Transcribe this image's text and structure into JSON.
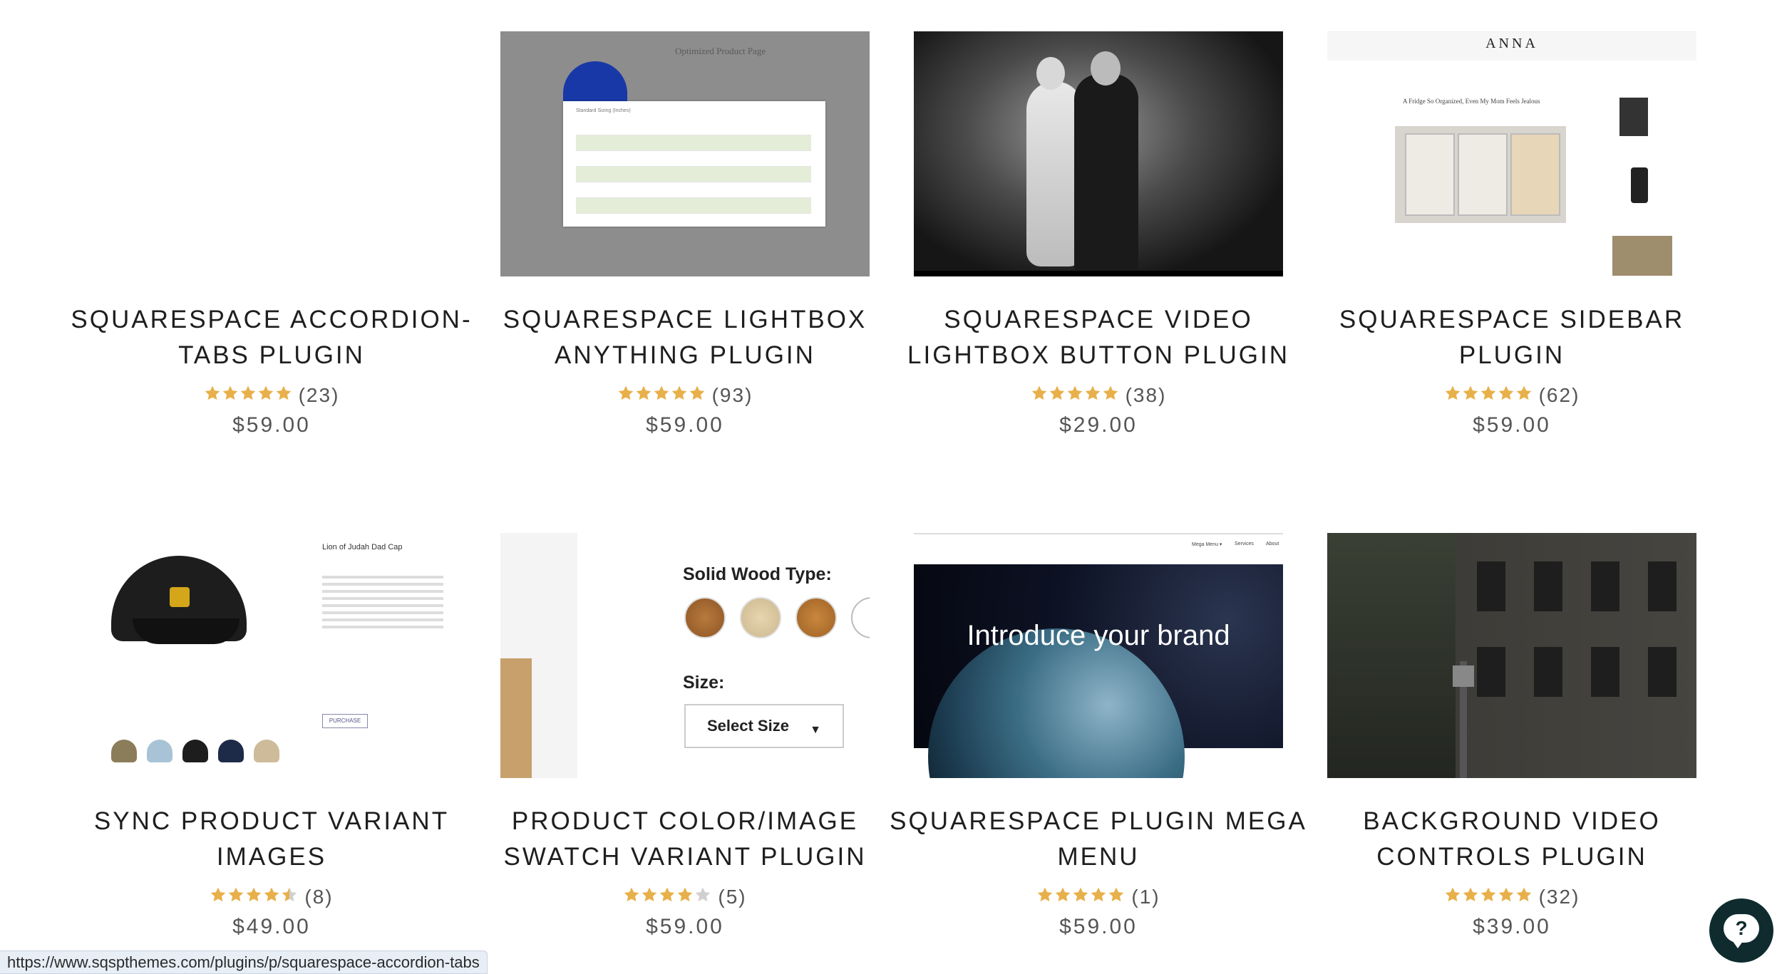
{
  "products": [
    {
      "title": "Squarespace Accordion-Tabs Plugin",
      "stars": 5,
      "count": "(23)",
      "price": "$59.00"
    },
    {
      "title": "Squarespace Lightbox Anything Plugin",
      "stars": 5,
      "count": "(93)",
      "price": "$59.00",
      "thumb_text": {
        "page_title": "Optimized Product Page",
        "modal_title": "Standard Sizing (Inches)"
      }
    },
    {
      "title": "Squarespace Video Lightbox Button Plugin",
      "stars": 5,
      "count": "(38)",
      "price": "$29.00"
    },
    {
      "title": "Squarespace Sidebar Plugin",
      "stars": 5,
      "count": "(62)",
      "price": "$59.00",
      "thumb_text": {
        "logo": "ANNA",
        "headline": "A Fridge So Organized, Even My Mom Feels Jealous"
      }
    },
    {
      "title": "Sync Product Variant Images",
      "stars": 4.5,
      "count": "(8)",
      "price": "$49.00",
      "thumb_text": {
        "product": "Lion of Judah Dad Cap",
        "button": "PURCHASE"
      }
    },
    {
      "title": "Product Color/Image Swatch Variant Plugin",
      "stars": 4,
      "count": "(5)",
      "price": "$59.00",
      "thumb_text": {
        "swatch_label": "Solid Wood Type:",
        "size_label": "Size:",
        "select_value": "Select Size"
      }
    },
    {
      "title": "Squarespace Plugin Mega Menu",
      "stars": 5,
      "count": "(1)",
      "price": "$59.00",
      "thumb_text": {
        "hero": "Introduce your brand",
        "nav": [
          "Mega Menu ▾",
          "Services",
          "About"
        ]
      }
    },
    {
      "title": "Background Video Controls Plugin",
      "stars": 5,
      "count": "(32)",
      "price": "$39.00"
    }
  ],
  "colors": {
    "star": "#e8b04a",
    "star_empty": "#d0d0d0",
    "help_button": "#0f2b2e"
  },
  "status_url": "https://www.sqspthemes.com/plugins/p/squarespace-accordion-tabs",
  "help_icon": "question-chat-icon"
}
